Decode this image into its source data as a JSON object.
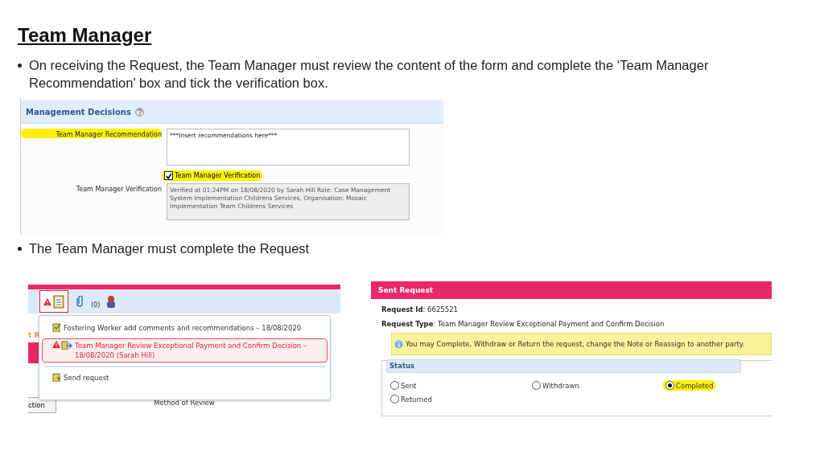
{
  "title": "Team Manager",
  "intro_bullet": "On receiving the Request, the Team Manager must review the content of the form and complete the ‘Team Manager Recommendation’ box and tick the verification box.",
  "management_decisions": {
    "heading": "Management Decisions",
    "recommendation": {
      "label": "Team Manager Recommendation",
      "highlighted": true,
      "value": "***Insert recommendations here***"
    },
    "verification_checkbox": {
      "label": "Team Manager Verification",
      "checked": true,
      "highlighted": true
    },
    "verification": {
      "label": "Team Manager Verification",
      "highlighted": false,
      "value": "Verified at 01:24PM on 18/08/2020 by Sarah  Hill Role: Case Management System Implementation Childrens Services, Organisation: Mosaic Implementation Team Childrens Services"
    }
  },
  "second_bullet": "The Team Manager must complete the Request",
  "request_menu": {
    "attachment_count": "(0)",
    "behind_tab": "t R",
    "behind_button": "ction",
    "behind_label": "Method of Review",
    "items": [
      {
        "kind": "done",
        "text": "Fostering Worker add comments and recommendations – 18/08/2020",
        "selected": false
      },
      {
        "kind": "warning",
        "text": "Team Manager Review Exceptional Payment and Confirm Decision – 18/08/2020 (Sarah Hill)",
        "selected": true
      },
      {
        "kind": "send",
        "text": "Send request",
        "selected": false
      }
    ]
  },
  "sent_request": {
    "title": "Sent Request",
    "fields": [
      "**Request Id**: 6625521",
      "**Request Type**: Team Manager Review Exceptional Payment and Confirm Decision"
    ],
    "info": "You may Complete, Withdraw or Return the request, change the Note or Reassign to another party.",
    "status_heading": "Status",
    "options": [
      {
        "label": "Sent",
        "selected": false,
        "highlighted": false
      },
      {
        "label": "Withdrawn",
        "selected": false,
        "highlighted": false
      },
      {
        "label": "Completed",
        "selected": true,
        "highlighted": true
      },
      {
        "label": "Returned",
        "selected": false,
        "highlighted": false
      }
    ]
  }
}
